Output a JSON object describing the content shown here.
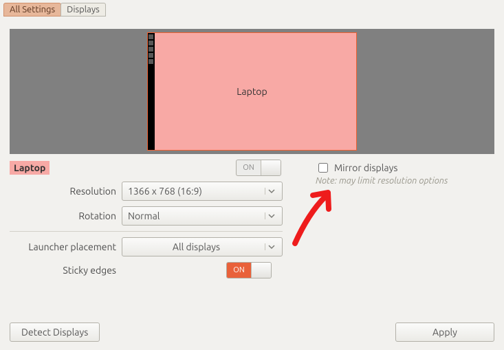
{
  "breadcrumb": {
    "all": "All Settings",
    "current": "Displays"
  },
  "preview": {
    "selected_display": "Laptop"
  },
  "display_panel": {
    "name": "Laptop",
    "power_switch_label": "ON",
    "power_state": "on"
  },
  "form": {
    "resolution": {
      "label": "Resolution",
      "value": "1366 x 768 (16:9)"
    },
    "rotation": {
      "label": "Rotation",
      "value": "Normal"
    },
    "launcher": {
      "label": "Launcher placement",
      "value": "All displays"
    },
    "sticky": {
      "label": "Sticky edges",
      "switch_label": "ON",
      "state": "on"
    }
  },
  "mirror": {
    "label": "Mirror displays",
    "checked": false,
    "note": "Note: may limit resolution options"
  },
  "buttons": {
    "detect": "Detect Displays",
    "apply": "Apply"
  },
  "annotation": {
    "type": "hand-drawn-arrow",
    "color": "#ee1c1c",
    "points_to": "mirror-displays-checkbox"
  }
}
